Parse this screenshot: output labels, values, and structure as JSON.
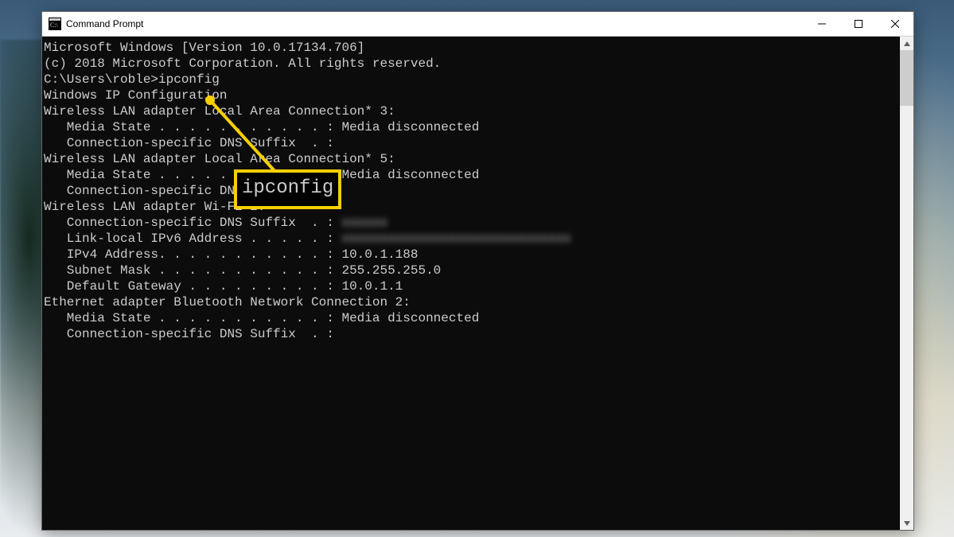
{
  "window": {
    "title": "Command Prompt"
  },
  "callout": {
    "label": "ipconfig"
  },
  "terminal": {
    "lines": [
      {
        "t": "Microsoft Windows [Version 10.0.17134.706]"
      },
      {
        "t": "(c) 2018 Microsoft Corporation. All rights reserved."
      },
      {
        "t": ""
      },
      {
        "t": "C:\\Users\\roble>ipconfig"
      },
      {
        "t": ""
      },
      {
        "t": "Windows IP Configuration"
      },
      {
        "t": ""
      },
      {
        "t": ""
      },
      {
        "t": "Wireless LAN adapter Local Area Connection* 3:"
      },
      {
        "t": ""
      },
      {
        "t": "   Media State . . . . . . . . . . . : Media disconnected"
      },
      {
        "t": "   Connection-specific DNS Suffix  . :"
      },
      {
        "t": ""
      },
      {
        "t": "Wireless LAN adapter Local Area Connection* 5:"
      },
      {
        "t": ""
      },
      {
        "t": "   Media State . . . . . . . . . . . : Media disconnected"
      },
      {
        "t": "   Connection-specific DNS Suffix  . :"
      },
      {
        "t": ""
      },
      {
        "t": "Wireless LAN adapter Wi-Fi 2:"
      },
      {
        "t": ""
      },
      {
        "t": "   Connection-specific DNS Suffix  . : ",
        "blur": "xxxxxx"
      },
      {
        "t": "   Link-local IPv6 Address . . . . . : ",
        "blur": "xxxxxxxxxxxxxxxxxxxxxxxxxxxxxx"
      },
      {
        "t": "   IPv4 Address. . . . . . . . . . . : 10.0.1.188"
      },
      {
        "t": "   Subnet Mask . . . . . . . . . . . : 255.255.255.0"
      },
      {
        "t": "   Default Gateway . . . . . . . . . : 10.0.1.1"
      },
      {
        "t": ""
      },
      {
        "t": "Ethernet adapter Bluetooth Network Connection 2:"
      },
      {
        "t": ""
      },
      {
        "t": "   Media State . . . . . . . . . . . : Media disconnected"
      },
      {
        "t": "   Connection-specific DNS Suffix  . :"
      }
    ]
  }
}
